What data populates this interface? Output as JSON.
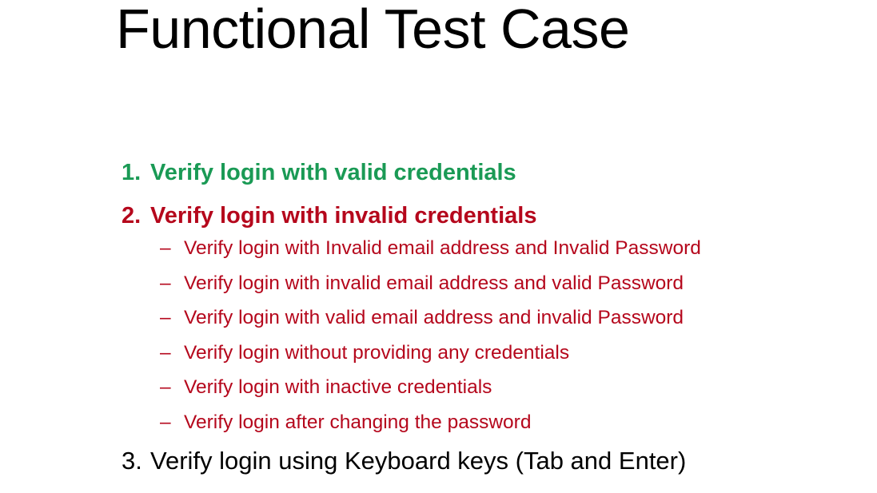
{
  "title": "Functional Test Case",
  "colors": {
    "green": "#1a9a55",
    "red": "#b5071c",
    "black": "#000000"
  },
  "items": [
    {
      "number": "1.",
      "text": "Verify login with valid credentials",
      "color": "#1a9a55",
      "bold": true
    },
    {
      "number": "2.",
      "text": "Verify login with invalid credentials",
      "color": "#b5071c",
      "bold": true,
      "sub_items": [
        {
          "dash": "–",
          "text": "Verify login with Invalid email address and Invalid Password"
        },
        {
          "dash": "–",
          "text": "Verify login with invalid email address and valid Password"
        },
        {
          "dash": "–",
          "text": "Verify login with valid email address and invalid Password"
        },
        {
          "dash": "–",
          "text": "Verify login without providing any credentials"
        },
        {
          "dash": "–",
          "text": "Verify login with inactive credentials"
        },
        {
          "dash": "–",
          "text": "Verify login after changing the password"
        }
      ]
    },
    {
      "number": "3.",
      "text": "Verify login using Keyboard keys (Tab and Enter)",
      "color": "#000000",
      "bold": false
    }
  ]
}
